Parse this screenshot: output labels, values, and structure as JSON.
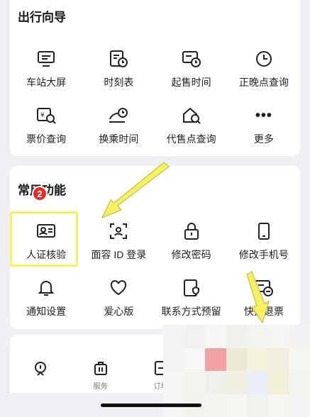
{
  "travel_guide": {
    "title": "出行向导",
    "items": [
      {
        "label": "车站大屏",
        "icon": "station-screen-icon"
      },
      {
        "label": "时刻表",
        "icon": "timetable-icon"
      },
      {
        "label": "起售时间",
        "icon": "sale-time-icon"
      },
      {
        "label": "正晚点查询",
        "icon": "clock-icon"
      },
      {
        "label": "票价查询",
        "icon": "fare-query-icon"
      },
      {
        "label": "换乘时间",
        "icon": "transfer-time-icon"
      },
      {
        "label": "代售点查询",
        "icon": "agency-search-icon"
      },
      {
        "label": "更多",
        "icon": "more-dots-icon"
      }
    ]
  },
  "common_functions": {
    "title": "常用功能",
    "step_badge": "2",
    "items": [
      {
        "label": "人证核验",
        "icon": "id-card-icon"
      },
      {
        "label": "面容 ID 登录",
        "icon": "face-id-icon"
      },
      {
        "label": "修改密码",
        "icon": "lock-icon"
      },
      {
        "label": "修改手机号",
        "icon": "phone-icon"
      },
      {
        "label": "通知设置",
        "icon": "bell-icon"
      },
      {
        "label": "爱心版",
        "icon": "heart-icon"
      },
      {
        "label": "联系方式预留",
        "icon": "contact-reserve-icon"
      },
      {
        "label": "快捷退票",
        "icon": "quick-refund-icon"
      }
    ]
  },
  "tabbar": {
    "items": [
      {
        "label": "",
        "icon": "home-train-icon"
      },
      {
        "label": "服务",
        "icon": "service-bag-icon"
      },
      {
        "label": "订单",
        "icon": "order-icon"
      }
    ]
  },
  "colors": {
    "highlight": "#f6f160",
    "badge": "#e22d2d",
    "card": "#ffffff",
    "background": "#eef0f3"
  }
}
